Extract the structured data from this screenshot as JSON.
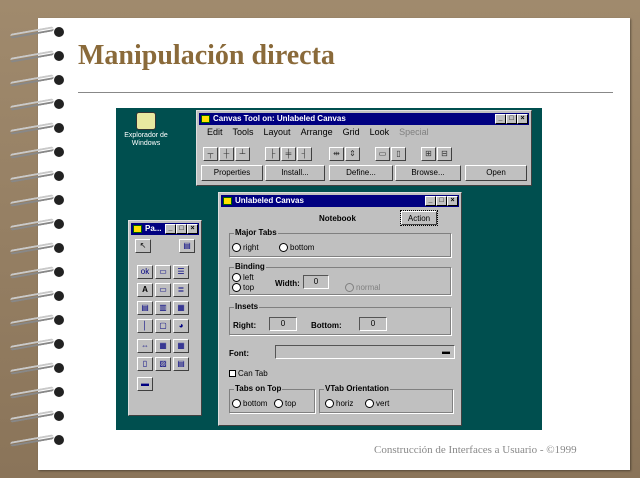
{
  "slide": {
    "title": "Manipulación directa",
    "footer": "Construcción de Interfaces a Usuario - ©1999"
  },
  "desktop": {
    "icon_label": "Explorador de Windows"
  },
  "canvas_tool": {
    "title": "Canvas Tool on: Unlabeled Canvas",
    "menu": [
      "Edit",
      "Tools",
      "Layout",
      "Arrange",
      "Grid",
      "Look",
      "Special"
    ],
    "buttons": [
      "Properties",
      "Install...",
      "Define...",
      "Browse...",
      "Open"
    ]
  },
  "palette": {
    "title": "Pa..."
  },
  "canvas": {
    "title": "Unlabeled Canvas",
    "notebook_label": "Notebook",
    "action_button": "Action",
    "major_tabs": {
      "label": "Major Tabs",
      "right": "right",
      "bottom": "bottom"
    },
    "binding": {
      "label": "Binding",
      "left": "left",
      "top": "top",
      "width_label": "Width:",
      "width_value": "0",
      "normal": "normal"
    },
    "insets": {
      "label": "Insets",
      "right_label": "Right:",
      "right_value": "0",
      "bottom_label": "Bottom:",
      "bottom_value": "0"
    },
    "font_label": "Font:",
    "can_tab": "Can Tab",
    "tabs_on_top": {
      "label": "Tabs on Top",
      "bottom": "bottom",
      "top": "top"
    },
    "vtab": {
      "label": "VTab Orientation",
      "horiz": "horiz",
      "vert": "vert"
    }
  },
  "window_buttons": {
    "min": "_",
    "max": "□",
    "close": "×"
  }
}
